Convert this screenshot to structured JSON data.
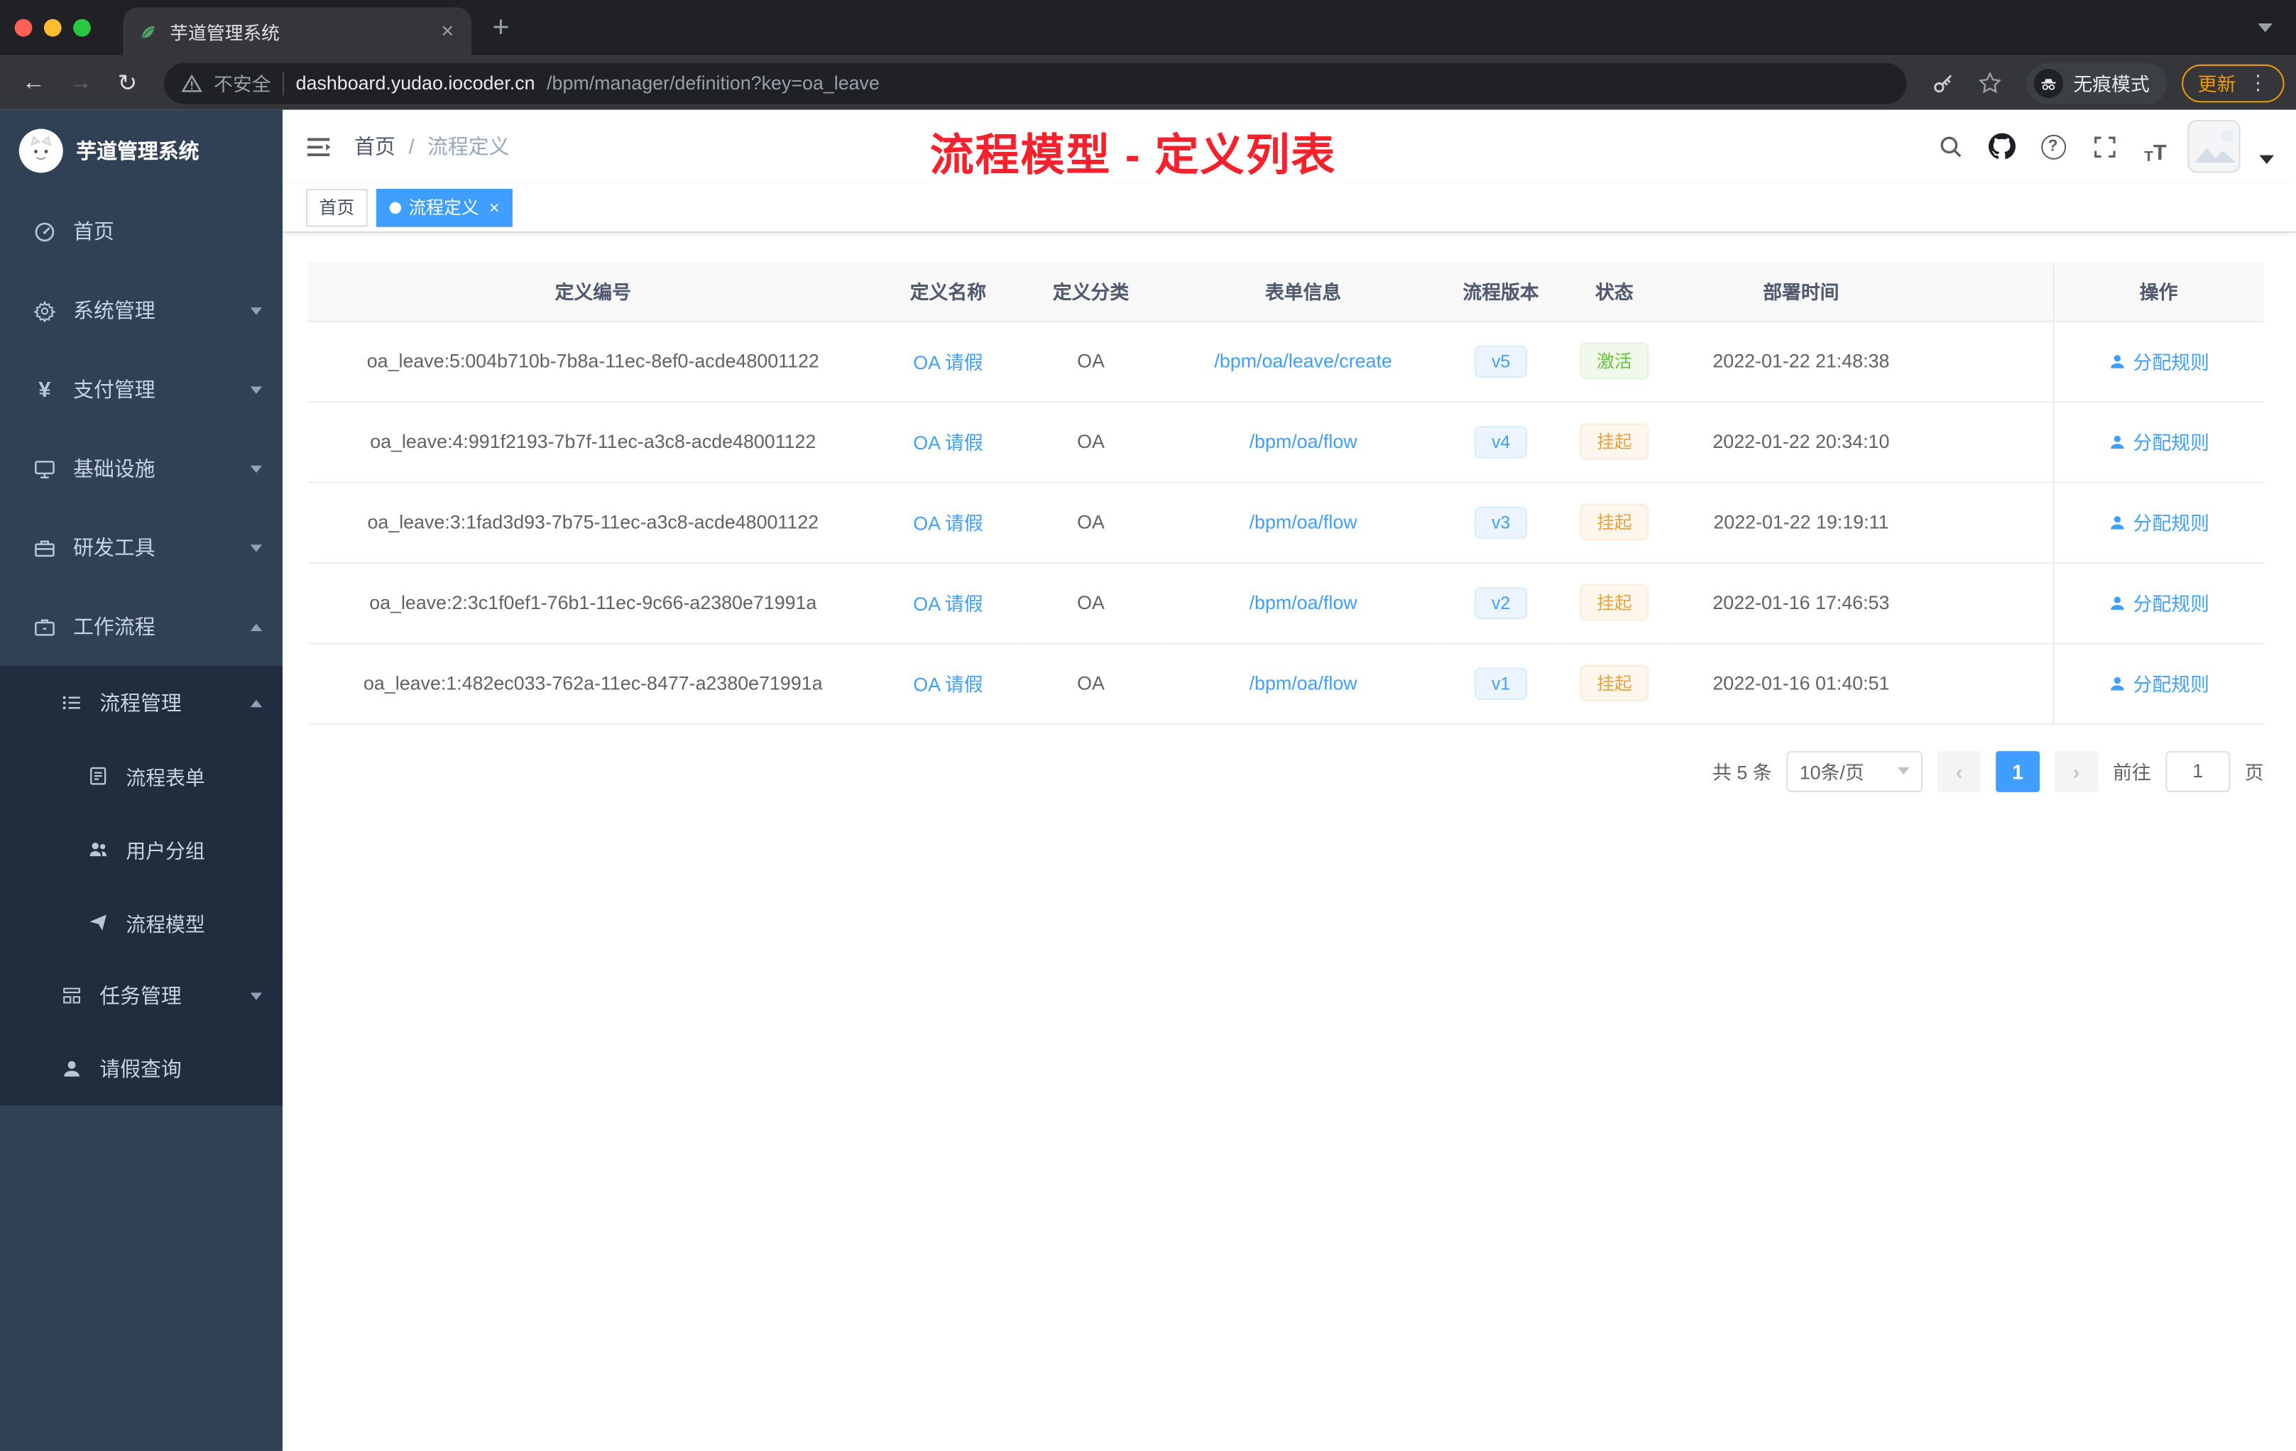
{
  "colors": {
    "accent": "#409eff",
    "annotation": "#f5222d",
    "status_active": "#67c23a",
    "status_suspended": "#e6a23c",
    "sidebar_bg": "#304156",
    "submenu_bg": "#1f2d3d"
  },
  "browser": {
    "tab_title": "芋道管理系统",
    "tab_close": "×",
    "new_tab": "+",
    "back_glyph": "←",
    "forward_glyph": "→",
    "reload_glyph": "↻",
    "security_label": "不安全",
    "url_host": "dashboard.yudao.iocoder.cn",
    "url_path": "/bpm/manager/definition?key=oa_leave",
    "profile_label": "无痕模式",
    "update_label": "更新",
    "menu_dots": "⋮"
  },
  "sidebar": {
    "app_title": "芋道管理系统",
    "items": [
      {
        "label": "首页",
        "level": 0
      },
      {
        "label": "系统管理",
        "level": 0,
        "expandable": true
      },
      {
        "label": "支付管理",
        "level": 0,
        "expandable": true
      },
      {
        "label": "基础设施",
        "level": 0,
        "expandable": true
      },
      {
        "label": "研发工具",
        "level": 0,
        "expandable": true
      },
      {
        "label": "工作流程",
        "level": 0,
        "expandable": true,
        "expanded": true
      },
      {
        "label": "流程管理",
        "level": 1,
        "expandable": true,
        "expanded": true
      },
      {
        "label": "流程表单",
        "level": 2
      },
      {
        "label": "用户分组",
        "level": 2
      },
      {
        "label": "流程模型",
        "level": 2
      },
      {
        "label": "任务管理",
        "level": 1,
        "expandable": true
      },
      {
        "label": "请假查询",
        "level": 1
      }
    ],
    "yuan_glyph": "¥"
  },
  "navbar": {
    "breadcrumb_root": "首页",
    "breadcrumb_separator": "/",
    "breadcrumb_current": "流程定义",
    "annotation": "流程模型 - 定义列表",
    "help_glyph": "?",
    "fontsize_small": "T",
    "fontsize_big": "T"
  },
  "tags": {
    "home": "首页",
    "active": "流程定义",
    "close": "×"
  },
  "table": {
    "columns": [
      "定义编号",
      "定义名称",
      "定义分类",
      "表单信息",
      "流程版本",
      "状态",
      "部署时间",
      "操作"
    ],
    "rows": [
      {
        "id": "oa_leave:5:004b710b-7b8a-11ec-8ef0-acde48001122",
        "name": "OA 请假",
        "category": "OA",
        "form": "/bpm/oa/leave/create",
        "version": "v5",
        "status": "激活",
        "status_type": "success",
        "deployed_at": "2022-01-22 21:48:38",
        "action": "分配规则"
      },
      {
        "id": "oa_leave:4:991f2193-7b7f-11ec-a3c8-acde48001122",
        "name": "OA 请假",
        "category": "OA",
        "form": "/bpm/oa/flow",
        "version": "v4",
        "status": "挂起",
        "status_type": "warning",
        "deployed_at": "2022-01-22 20:34:10",
        "action": "分配规则"
      },
      {
        "id": "oa_leave:3:1fad3d93-7b75-11ec-a3c8-acde48001122",
        "name": "OA 请假",
        "category": "OA",
        "form": "/bpm/oa/flow",
        "version": "v3",
        "status": "挂起",
        "status_type": "warning",
        "deployed_at": "2022-01-22 19:19:11",
        "action": "分配规则"
      },
      {
        "id": "oa_leave:2:3c1f0ef1-76b1-11ec-9c66-a2380e71991a",
        "name": "OA 请假",
        "category": "OA",
        "form": "/bpm/oa/flow",
        "version": "v2",
        "status": "挂起",
        "status_type": "warning",
        "deployed_at": "2022-01-16 17:46:53",
        "action": "分配规则"
      },
      {
        "id": "oa_leave:1:482ec033-762a-11ec-8477-a2380e71991a",
        "name": "OA 请假",
        "category": "OA",
        "form": "/bpm/oa/flow",
        "version": "v1",
        "status": "挂起",
        "status_type": "warning",
        "deployed_at": "2022-01-16 01:40:51",
        "action": "分配规则"
      }
    ]
  },
  "pagination": {
    "total": "共 5 条",
    "page_size": "10条/页",
    "prev": "‹",
    "page": "1",
    "next": "›",
    "goto_label": "前往",
    "goto_value": "1",
    "goto_unit": "页"
  }
}
